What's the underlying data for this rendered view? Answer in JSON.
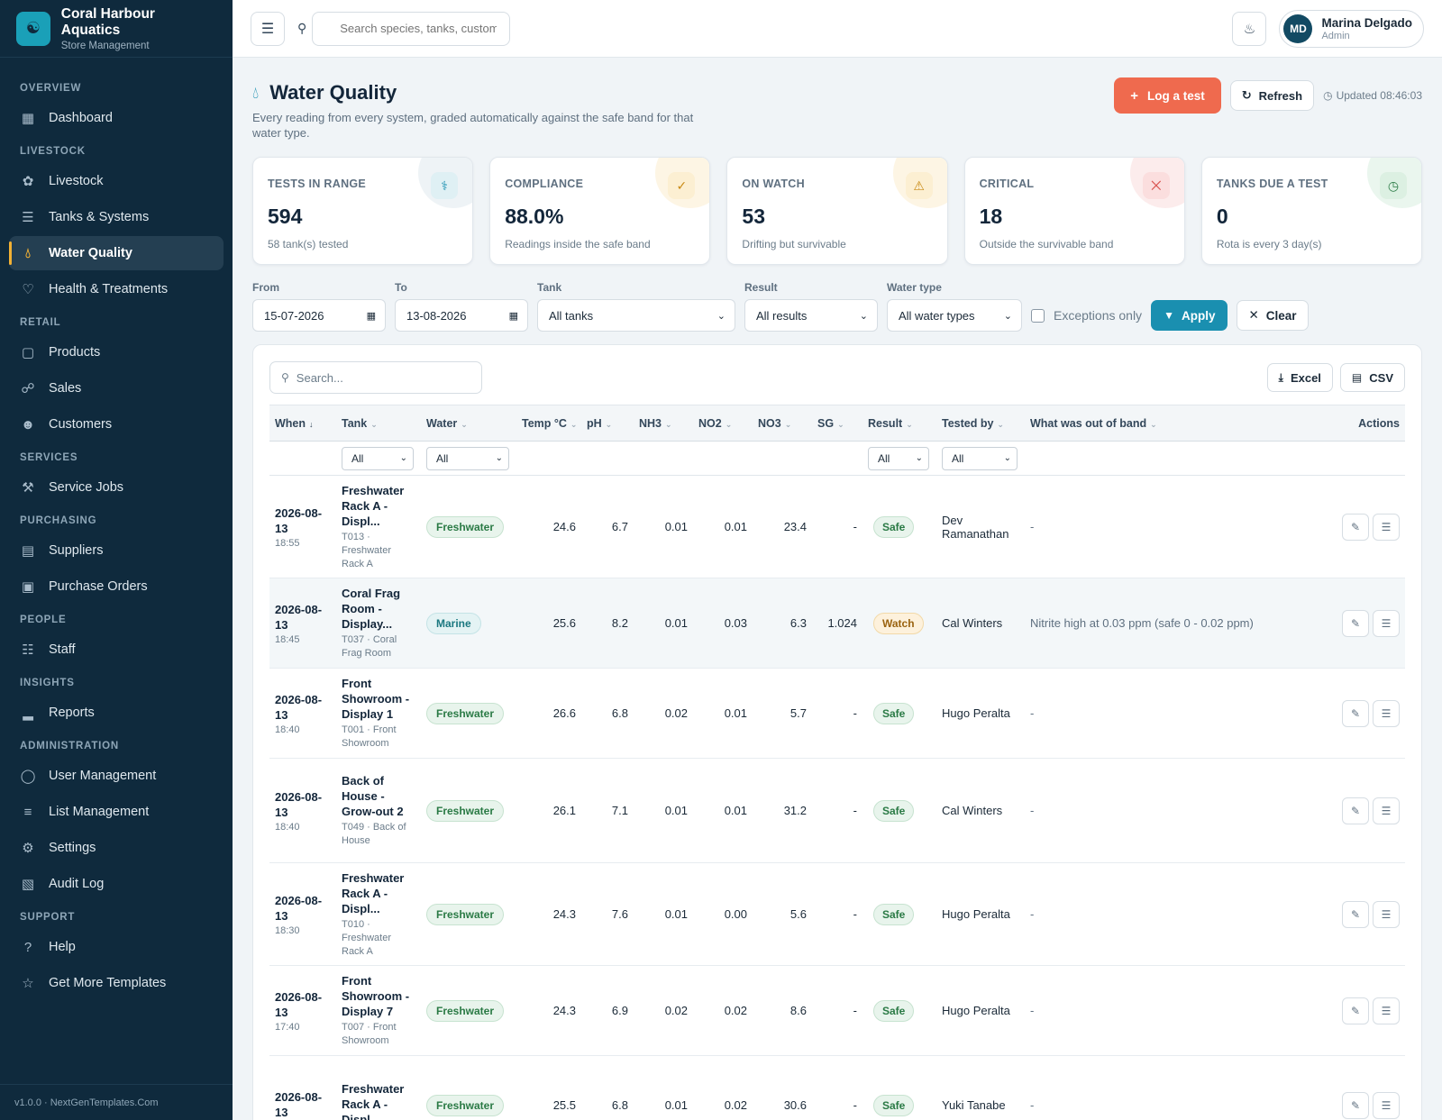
{
  "brand": {
    "name": "Coral Harbour Aquatics",
    "sub": "Store Management"
  },
  "nav": {
    "overview": "OVERVIEW",
    "dashboard": "Dashboard",
    "livestock_section": "LIVESTOCK",
    "livestock": "Livestock",
    "tanks": "Tanks & Systems",
    "water": "Water Quality",
    "health": "Health & Treatments",
    "retail": "RETAIL",
    "products": "Products",
    "sales": "Sales",
    "customers": "Customers",
    "services": "SERVICES",
    "service_jobs": "Service Jobs",
    "purchasing": "PURCHASING",
    "suppliers": "Suppliers",
    "purchase_orders": "Purchase Orders",
    "people": "PEOPLE",
    "staff": "Staff",
    "insights": "INSIGHTS",
    "reports": "Reports",
    "administration": "ADMINISTRATION",
    "user_mgmt": "User Management",
    "list_mgmt": "List Management",
    "settings": "Settings",
    "audit": "Audit Log",
    "support": "SUPPORT",
    "help": "Help",
    "templates": "Get More Templates"
  },
  "footer": "v1.0.0 · NextGenTemplates.Com",
  "topbar": {
    "search_placeholder": "Search species, tanks, customers...",
    "user_name": "Marina Delgado",
    "user_role": "Admin",
    "initials": "MD"
  },
  "page": {
    "title": "Water Quality",
    "desc": "Every reading from every system, graded automatically against the safe band for that water type.",
    "log_btn": "Log a test",
    "refresh_btn": "Refresh",
    "updated": "Updated 08:46:03"
  },
  "stats": [
    {
      "label": "TESTS IN RANGE",
      "value": "594",
      "sub": "58 tank(s) tested"
    },
    {
      "label": "COMPLIANCE",
      "value": "88.0%",
      "sub": "Readings inside the safe band"
    },
    {
      "label": "ON WATCH",
      "value": "53",
      "sub": "Drifting but survivable"
    },
    {
      "label": "CRITICAL",
      "value": "18",
      "sub": "Outside the survivable band"
    },
    {
      "label": "TANKS DUE A TEST",
      "value": "0",
      "sub": "Rota is every 3 day(s)"
    }
  ],
  "filters": {
    "from_label": "From",
    "from": "15-07-2026",
    "to_label": "To",
    "to": "13-08-2026",
    "tank_label": "Tank",
    "tank": "All tanks",
    "result_label": "Result",
    "result": "All results",
    "water_label": "Water type",
    "water": "All water types",
    "exceptions": "Exceptions only",
    "apply": "Apply",
    "clear": "Clear"
  },
  "table": {
    "search_placeholder": "Search...",
    "excel": "Excel",
    "csv": "CSV",
    "headers": {
      "when": "When",
      "tank": "Tank",
      "water": "Water",
      "temp": "Temp °C",
      "ph": "pH",
      "nh3": "NH3",
      "no2": "NO2",
      "no3": "NO3",
      "sg": "SG",
      "result": "Result",
      "tested_by": "Tested by",
      "oob": "What was out of band",
      "actions": "Actions"
    },
    "filter_all": "All",
    "rows": [
      {
        "date": "2026-08-13",
        "time": "18:55",
        "tank": "Freshwater Rack A - Displ...",
        "tank_sub": "T013 · Freshwater Rack A",
        "water": "Freshwater",
        "temp": "24.6",
        "ph": "6.7",
        "nh3": "0.01",
        "no2": "0.01",
        "no3": "23.4",
        "sg": "-",
        "result": "Safe",
        "by": "Dev Ramanathan",
        "oob": "-"
      },
      {
        "date": "2026-08-13",
        "time": "18:45",
        "tank": "Coral Frag Room - Display...",
        "tank_sub": "T037 · Coral Frag Room",
        "water": "Marine",
        "temp": "25.6",
        "ph": "8.2",
        "nh3": "0.01",
        "no2": "0.03",
        "no3": "6.3",
        "sg": "1.024",
        "result": "Watch",
        "by": "Cal Winters",
        "oob": "Nitrite high at 0.03 ppm (safe 0 - 0.02 ppm)"
      },
      {
        "date": "2026-08-13",
        "time": "18:40",
        "tank": "Front Showroom - Display 1",
        "tank_sub": "T001 · Front Showroom",
        "water": "Freshwater",
        "temp": "26.6",
        "ph": "6.8",
        "nh3": "0.02",
        "no2": "0.01",
        "no3": "5.7",
        "sg": "-",
        "result": "Safe",
        "by": "Hugo Peralta",
        "oob": "-"
      },
      {
        "date": "2026-08-13",
        "time": "18:40",
        "tank": "Back of House - Grow-out 2",
        "tank_sub": "T049 · Back of House",
        "water": "Freshwater",
        "temp": "26.1",
        "ph": "7.1",
        "nh3": "0.01",
        "no2": "0.01",
        "no3": "31.2",
        "sg": "-",
        "result": "Safe",
        "by": "Cal Winters",
        "oob": "-"
      },
      {
        "date": "2026-08-13",
        "time": "18:30",
        "tank": "Freshwater Rack A - Displ...",
        "tank_sub": "T010 · Freshwater Rack A",
        "water": "Freshwater",
        "temp": "24.3",
        "ph": "7.6",
        "nh3": "0.01",
        "no2": "0.00",
        "no3": "5.6",
        "sg": "-",
        "result": "Safe",
        "by": "Hugo Peralta",
        "oob": "-"
      },
      {
        "date": "2026-08-13",
        "time": "17:40",
        "tank": "Front Showroom - Display 7",
        "tank_sub": "T007 · Front Showroom",
        "water": "Freshwater",
        "temp": "24.3",
        "ph": "6.9",
        "nh3": "0.02",
        "no2": "0.02",
        "no3": "8.6",
        "sg": "-",
        "result": "Safe",
        "by": "Hugo Peralta",
        "oob": "-"
      },
      {
        "date": "2026-08-13",
        "time": "",
        "tank": "Freshwater Rack A - Displ...",
        "tank_sub": "",
        "water": "Freshwater",
        "temp": "25.5",
        "ph": "6.8",
        "nh3": "0.01",
        "no2": "0.02",
        "no3": "30.6",
        "sg": "-",
        "result": "Safe",
        "by": "Yuki Tanabe",
        "oob": "-"
      }
    ]
  },
  "colors": {
    "sidebar": "#0f2a3d",
    "accent": "#1a8fb0",
    "primary_action": "#ef6a4e",
    "active_marker": "#f2b134"
  }
}
